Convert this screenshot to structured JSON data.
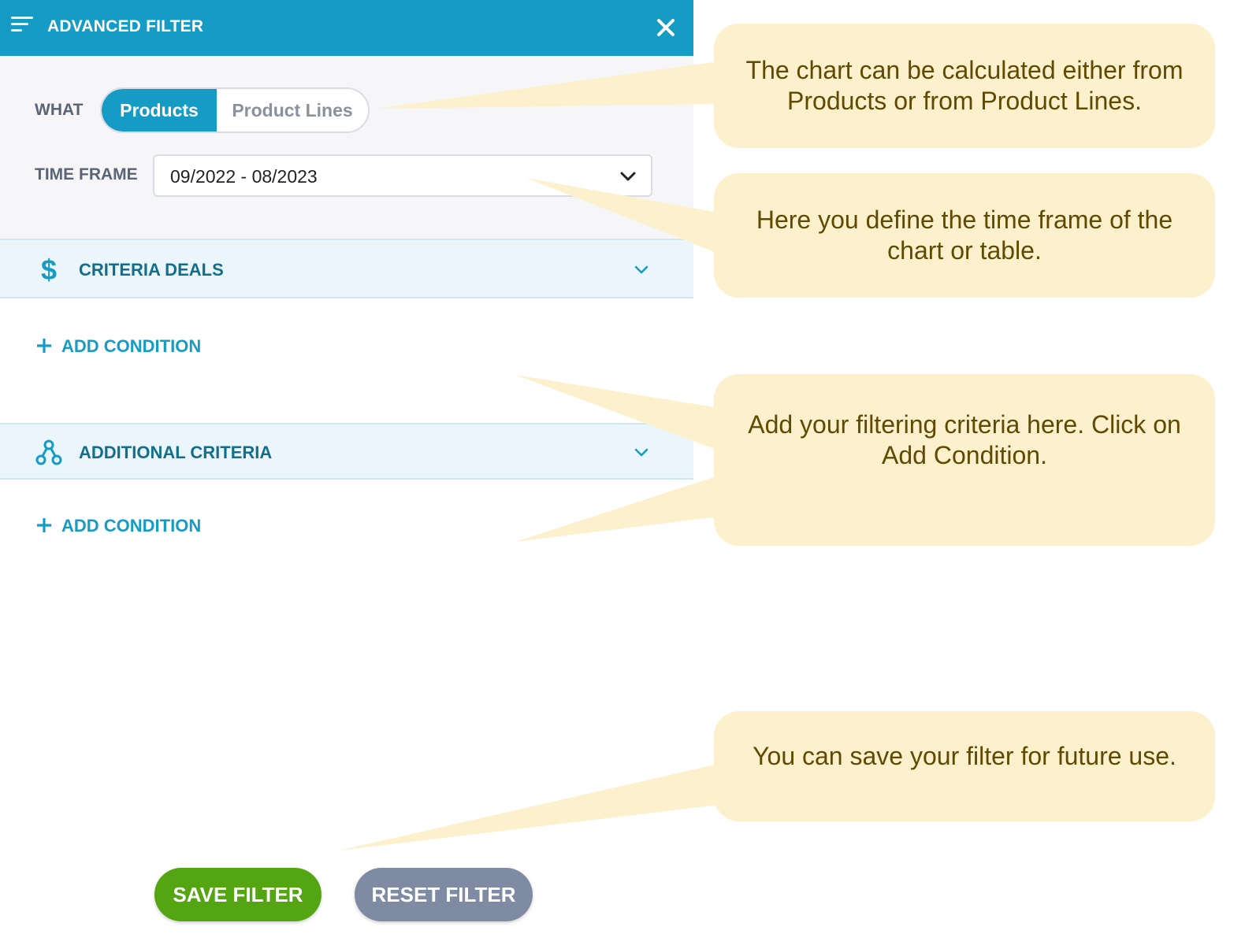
{
  "header": {
    "title": "ADVANCED FILTER",
    "menu_icon": "filter-lines-icon",
    "close_icon": "close-icon"
  },
  "what": {
    "label": "WHAT",
    "options": [
      "Products",
      "Product Lines"
    ],
    "selected": "Products"
  },
  "time_frame": {
    "label": "TIME FRAME",
    "value": "09/2022 - 08/2023",
    "icon": "chevron-down-icon"
  },
  "sections": [
    {
      "title": "CRITERIA DEALS",
      "icon": "dollar-icon",
      "add_label": "ADD CONDITION"
    },
    {
      "title": "ADDITIONAL CRITERIA",
      "icon": "network-nodes-icon",
      "add_label": "ADD CONDITION"
    }
  ],
  "buttons": {
    "save": "SAVE FILTER",
    "reset": "RESET FILTER"
  },
  "callouts": [
    "The chart can be calculated either from Products or from Product Lines.",
    "Here you define the time frame of the chart or table.",
    "Add your filtering criteria here. Click on Add Condition.",
    "You can save your filter for future use."
  ],
  "colors": {
    "header": "#169bc4",
    "accent": "#169bc4",
    "section_title": "#126f8c",
    "save_button": "#53a512",
    "reset_button": "#7f8ba3",
    "callout_bg": "#fdf0cd",
    "callout_text": "#5e4a00"
  }
}
